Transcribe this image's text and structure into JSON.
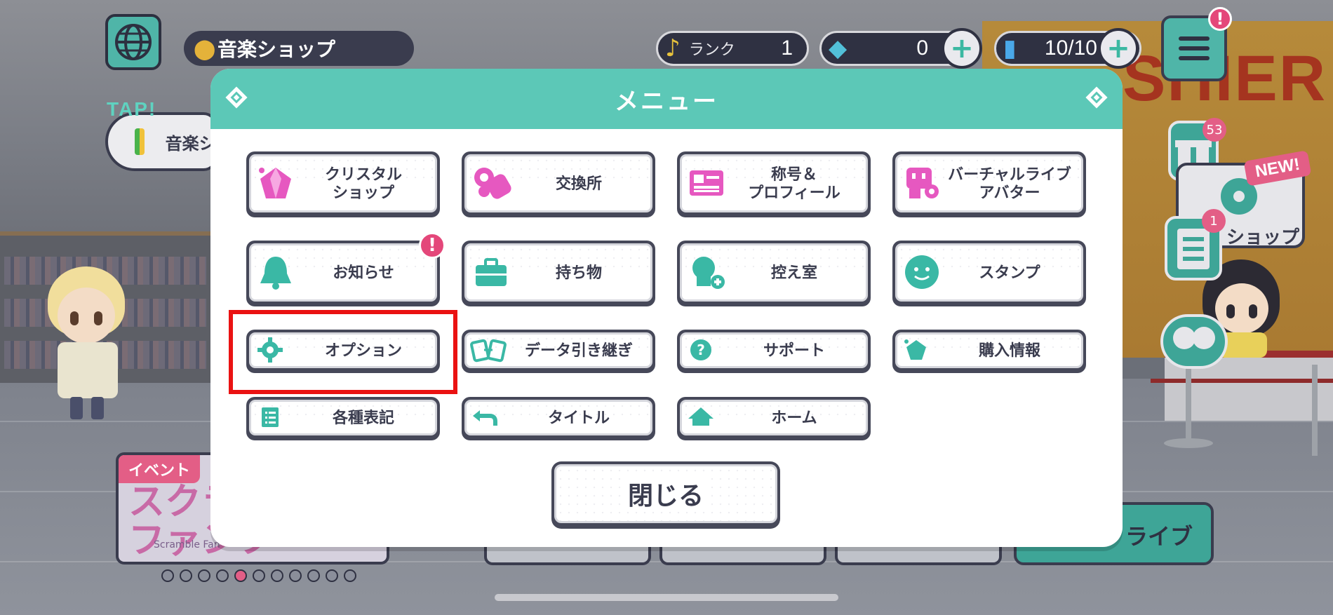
{
  "hud": {
    "location": "音楽ショップ",
    "tap_label": "TAP!",
    "mission_label": "音楽シ",
    "rank_label": "ランク",
    "rank_value": "1",
    "gems_value": "0",
    "stamina_value": "10/10",
    "menu_alert": "!",
    "gift_count": "53",
    "notes_count": "1",
    "new_badge": "NEW!",
    "shop_label": "ショップ",
    "event_tag": "イベント",
    "event_title": "スクラン\nファンフ",
    "event_subtitle": "Scramble Fan",
    "live_label": "ライブ",
    "cashier_sign": "SHIER",
    "event_page_count": 11,
    "event_page_active": 5
  },
  "modal": {
    "title": "メニュー",
    "notice_badge": "!",
    "buttons": {
      "crystal_shop": "クリスタル\nショップ",
      "exchange": "交換所",
      "title_profile": "称号＆\nプロフィール",
      "virtual_live_avatar": "バーチャルライブ\nアバター",
      "notice": "お知らせ",
      "items": "持ち物",
      "waiting_room": "控え室",
      "stamp": "スタンプ",
      "option": "オプション",
      "data_transfer": "データ引き継ぎ",
      "support": "サポート",
      "purchase_info": "購入情報",
      "legal": "各種表記",
      "title_screen": "タイトル",
      "home": "ホーム"
    },
    "close": "閉じる"
  },
  "colors": {
    "accent_teal": "#5cc8b7",
    "icon_pink": "#e658c0",
    "icon_teal": "#3ab8a5",
    "alert_pink": "#e4477a",
    "highlight_red": "#ea1212"
  }
}
